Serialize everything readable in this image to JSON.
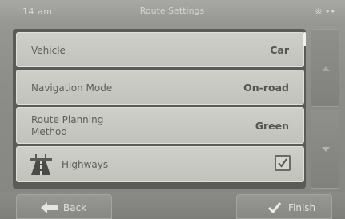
{
  "topbar": {
    "time": "14 am",
    "title": "Route Settings",
    "status": "※ ••"
  },
  "settings": {
    "rows": [
      {
        "label": "Vehicle",
        "value": "Car"
      },
      {
        "label": "Navigation Mode",
        "value": "On-road"
      },
      {
        "label": "Route Planning\nMethod",
        "value": "Green"
      },
      {
        "label": "Highways",
        "checked": true,
        "icon": "highway-icon"
      }
    ]
  },
  "scroll": {
    "up_icon": "scroll-up-arrow-icon",
    "down_icon": "scroll-down-arrow-icon"
  },
  "footer": {
    "back_label": "Back",
    "back_icon": "arrow-left-icon",
    "finish_label": "Finish",
    "finish_icon": "checkmark-icon"
  },
  "colors": {
    "background": "#8a8a86",
    "row": "#c8c8c3",
    "panel": "#5a5a56",
    "text": "#5e5e5a"
  }
}
